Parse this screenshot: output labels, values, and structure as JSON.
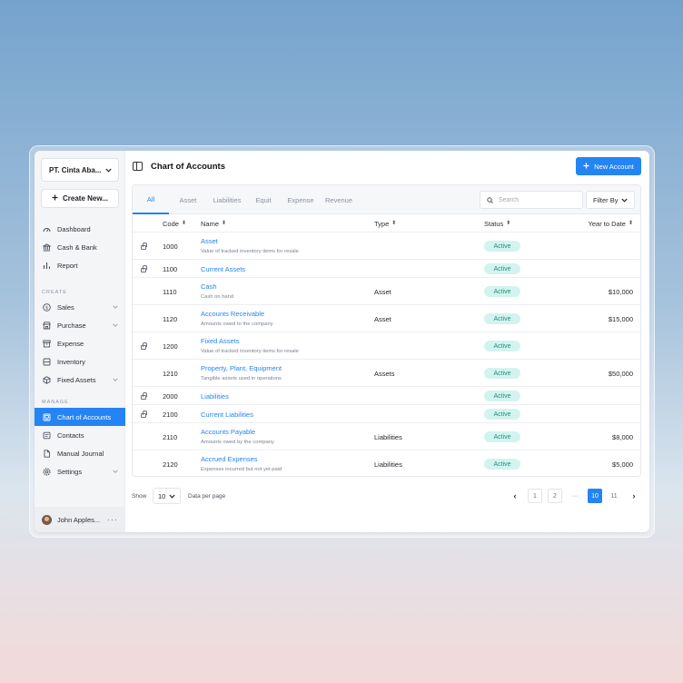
{
  "sidebar": {
    "company": "PT. Cinta Aba...",
    "create_label": "Create New...",
    "top_items": [
      {
        "label": "Dashboard",
        "icon": "dashboard-icon"
      },
      {
        "label": "Cash & Bank",
        "icon": "bank-icon"
      },
      {
        "label": "Report",
        "icon": "bar-chart-icon"
      }
    ],
    "create_section": "CREATE",
    "create_items": [
      {
        "label": "Sales",
        "icon": "dollar-icon",
        "expandable": true
      },
      {
        "label": "Purchase",
        "icon": "store-icon",
        "expandable": true
      },
      {
        "label": "Expense",
        "icon": "archive-icon",
        "expandable": false
      },
      {
        "label": "Inventory",
        "icon": "box-icon",
        "expandable": false
      },
      {
        "label": "Fixed Assets",
        "icon": "cube-icon",
        "expandable": true
      }
    ],
    "manage_section": "MANAGE",
    "manage_items": [
      {
        "label": "Chart of Accounts",
        "icon": "ledger-icon",
        "active": true
      },
      {
        "label": "Contacts",
        "icon": "contacts-icon"
      },
      {
        "label": "Manual Journal",
        "icon": "document-icon"
      },
      {
        "label": "Settings",
        "icon": "gear-icon",
        "expandable": true
      }
    ],
    "user_name": "John Apples...",
    "user_more": "···"
  },
  "header": {
    "title": "Chart of Accounts",
    "new_button": "New Account"
  },
  "tabs": [
    "All",
    "Asset",
    "Liabilities",
    "Equit",
    "Expense",
    "Revenue"
  ],
  "search": {
    "placeholder": "Search"
  },
  "filter_label": "Filter By",
  "columns": {
    "code": "Code",
    "name": "Name",
    "type": "Type",
    "status": "Status",
    "ytd": "Year to Date"
  },
  "rows": [
    {
      "locked": true,
      "code": "1000",
      "name": "Asset",
      "desc": "Value of tracked inventory items for resale",
      "type": "",
      "status": "Active",
      "ytd": ""
    },
    {
      "locked": true,
      "code": "1100",
      "name": "Current Assets",
      "desc": "",
      "type": "",
      "status": "Active",
      "ytd": ""
    },
    {
      "locked": false,
      "code": "1110",
      "name": "Cash",
      "desc": "Cash on hand",
      "type": "Asset",
      "status": "Active",
      "ytd": "$10,000"
    },
    {
      "locked": false,
      "code": "1120",
      "name": "Accounts Receivable",
      "desc": "Amounts owed to the company",
      "type": "Asset",
      "status": "Active",
      "ytd": "$15,000"
    },
    {
      "locked": true,
      "code": "1200",
      "name": "Fixed Assets",
      "desc": "Value of tracked inventory items for resale",
      "type": "",
      "status": "Active",
      "ytd": ""
    },
    {
      "locked": false,
      "code": "1210",
      "name": "Property, Plant, Equipment",
      "desc": "Tangible assets used in operations",
      "type": "Assets",
      "status": "Active",
      "ytd": "$50,000"
    },
    {
      "locked": true,
      "code": "2000",
      "name": "Liabilities",
      "desc": "",
      "type": "",
      "status": "Active",
      "ytd": ""
    },
    {
      "locked": true,
      "code": "2100",
      "name": "Current Liabilities",
      "desc": "",
      "type": "",
      "status": "Active",
      "ytd": ""
    },
    {
      "locked": false,
      "code": "2110",
      "name": "Accounts Payable",
      "desc": "Amounts owed by the company",
      "type": "Liabilities",
      "status": "Active",
      "ytd": "$8,000"
    },
    {
      "locked": false,
      "code": "2120",
      "name": "Accrued Expenses",
      "desc": "Expenses incurred but not yet paid",
      "type": "Liabilities",
      "status": "Active",
      "ytd": "$5,000"
    }
  ],
  "footer": {
    "show_label": "Show",
    "per_page": "10",
    "per_page_label": "Data per page",
    "pages": [
      "1",
      "2",
      "···",
      "10",
      "11"
    ],
    "current_page": "10"
  },
  "colors": {
    "accent": "#2584f3",
    "badge_bg": "#d3f4ee",
    "badge_text": "#1f8f7c"
  }
}
